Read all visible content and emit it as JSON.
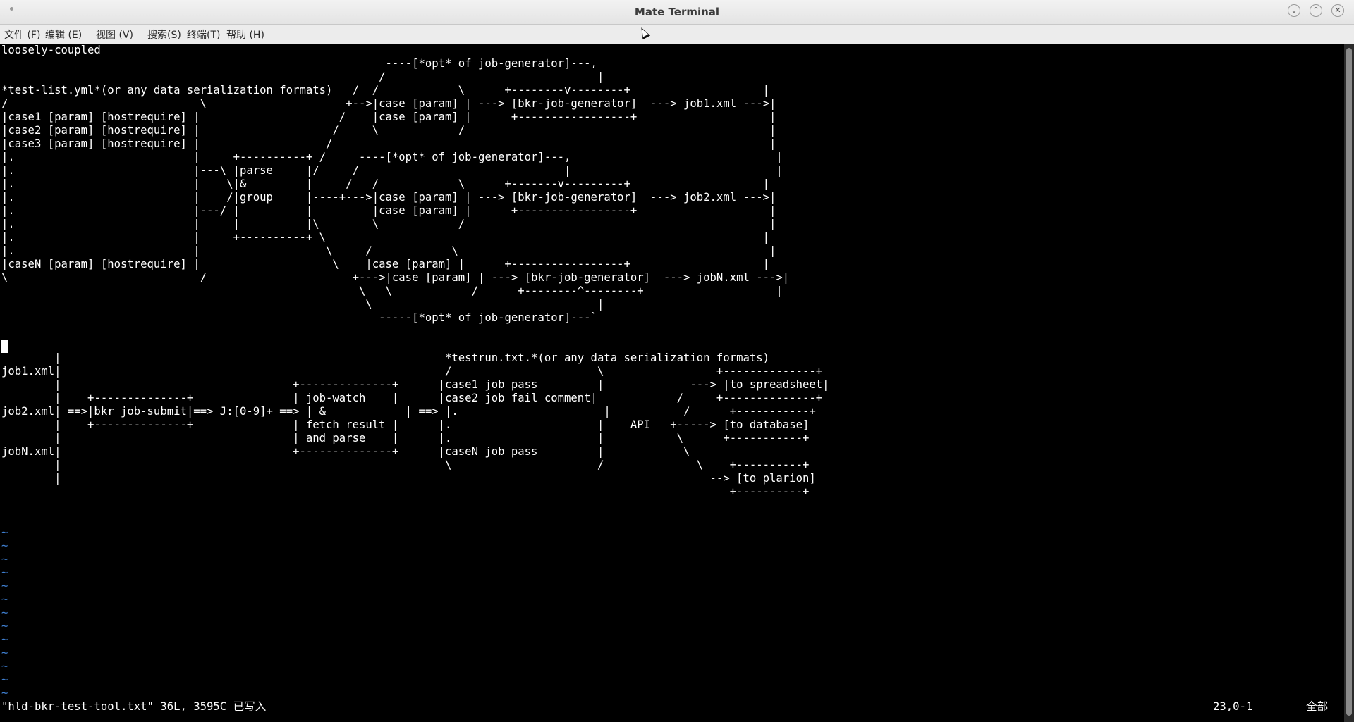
{
  "window": {
    "title": "Mate Terminal",
    "buttons": {
      "minimize": "⌄",
      "maximize": "⌃",
      "close": "✕"
    }
  },
  "menubar": {
    "items": [
      {
        "label": "文件 (F)"
      },
      {
        "label": "编辑 (E)"
      },
      {
        "label": "视图 (V)"
      },
      {
        "label": "搜索(S)"
      },
      {
        "label": "终端(T)"
      },
      {
        "label": "帮助 (H)"
      }
    ]
  },
  "terminal": {
    "content": "loosely-coupled\n                                                          ----[*opt* of job-generator]---,\n                                                         /                                |\n*test-list.yml*(or any data serialization formats)   /  /            \\      +--------v--------+                    |\n/                             \\                     +-->|case [param] | ---> [bkr-job-generator]  ---> job1.xml --->|\n|case1 [param] [hostrequire] |                     /    |case [param] |      +-----------------+                    |\n|case2 [param] [hostrequire] |                    /     \\            /                                              |\n|case3 [param] [hostrequire] |                   /                                                                  |\n|.                           |     +----------+ /     ----[*opt* of job-generator]---,                               |\n|.                           |---\\ |parse     |/     /                               |                               |\n|.                           |    \\|&         |     /   /            \\      +-------v---------+                    |\n|.                           |    /|group     |----+--->|case [param] | ---> [bkr-job-generator]  ---> job2.xml --->|\n|.                           |---/ |          |         |case [param] |      +-----------------+                    |\n|.                           |     |          |\\        \\            /                                              |\n|.                           |     +----------+ \\                                                                  |\n|.                           |                   \\     /            \\                                               |\n|caseN [param] [hostrequire] |                    \\    |case [param] |      +-----------------+                    |\n\\                             /                      +--->|case [param] | ---> [bkr-job-generator]  ---> jobN.xml --->|\n                                                      \\   \\            /      +--------^--------+                    |\n                                                       \\                                  |\n                                                         -----[*opt* of job-generator]---`\n\n\n        |                                                          *testrun.txt.*(or any data serialization formats)\njob1.xml|                                                          /                      \\                 +--------------+\n        |                                   +--------------+      |case1 job pass         |             ---> |to spreadsheet|\n        |    +--------------+               | job-watch    |      |case2 job fail comment|            /     +--------------+\njob2.xml| ==>|bkr job-submit|==> J:[0-9]+ ==> | &            | ==> |.                      |           /      +-----------+\n        |    +--------------+               | fetch result |      |.                      |    API   +-----> [to database]\n        |                                   | and parse    |      |.                      |           \\      +-----------+\njobN.xml|                                   +--------------+      |caseN job pass         |            \\\n        |                                                          \\                      /              \\    +----------+\n        |                                                                                                  --> [to plarion]\n                                                                                                              +----------+",
    "tildes": "~\n~\n~\n~\n~\n~\n~\n~\n~\n~\n~\n~\n~"
  },
  "statusline": {
    "file_info": "\"hld-bkr-test-tool.txt\" 36L, 3595C 已写入",
    "position": "23,0-1",
    "scroll": "全部"
  }
}
